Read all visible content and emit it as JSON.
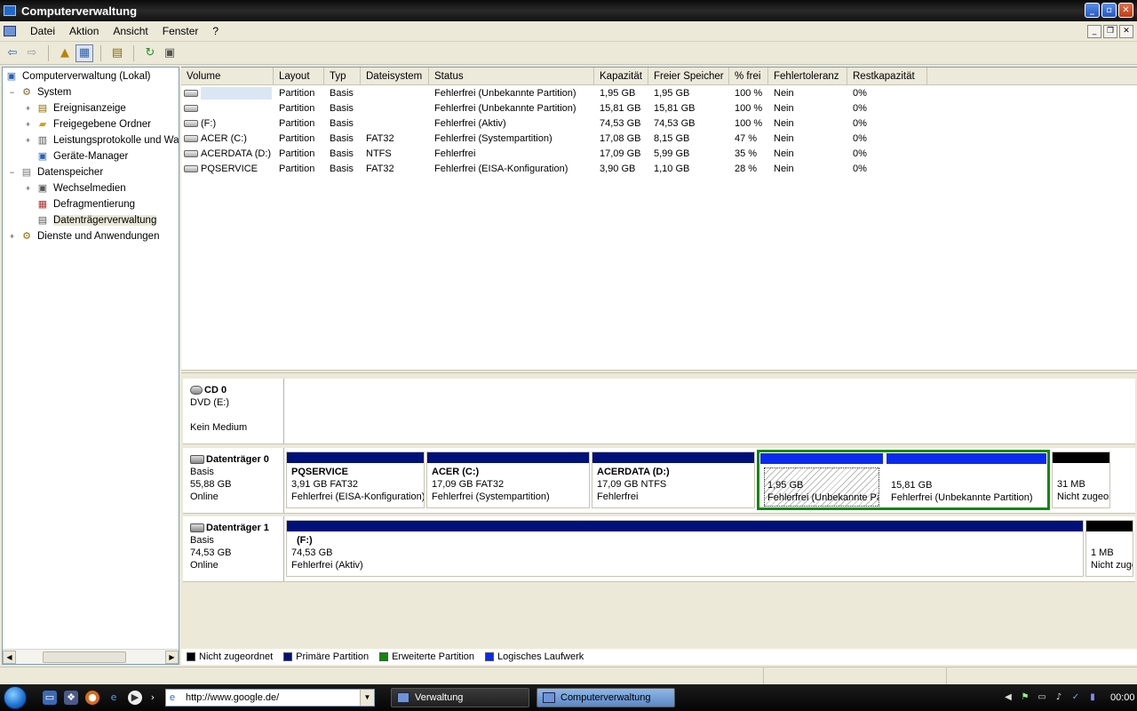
{
  "window": {
    "title": "Computerverwaltung"
  },
  "menu": [
    "Datei",
    "Aktion",
    "Ansicht",
    "Fenster",
    "?"
  ],
  "tree": [
    {
      "label": "Computerverwaltung (Lokal)",
      "level": 0,
      "expander": "",
      "icon": "computer-icon"
    },
    {
      "label": "System",
      "level": 1,
      "expander": "−",
      "icon": "system-icon"
    },
    {
      "label": "Ereignisanzeige",
      "level": 2,
      "expander": "+",
      "icon": "event-viewer-icon"
    },
    {
      "label": "Freigegebene Ordner",
      "level": 2,
      "expander": "+",
      "icon": "shared-folder-icon"
    },
    {
      "label": "Leistungsprotokolle und Warnungen",
      "level": 2,
      "expander": "+",
      "icon": "performance-icon"
    },
    {
      "label": "Geräte-Manager",
      "level": 2,
      "expander": "",
      "icon": "device-manager-icon"
    },
    {
      "label": "Datenspeicher",
      "level": 1,
      "expander": "−",
      "icon": "storage-icon"
    },
    {
      "label": "Wechselmedien",
      "level": 2,
      "expander": "+",
      "icon": "removable-media-icon"
    },
    {
      "label": "Defragmentierung",
      "level": 2,
      "expander": "",
      "icon": "defrag-icon"
    },
    {
      "label": "Datenträgerverwaltung",
      "level": 2,
      "expander": "",
      "icon": "disk-management-icon",
      "selected": true
    },
    {
      "label": "Dienste und Anwendungen",
      "level": 1,
      "expander": "+",
      "icon": "services-icon"
    }
  ],
  "volumes": {
    "columns": [
      "Volume",
      "Layout",
      "Typ",
      "Dateisystem",
      "Status",
      "Kapazität",
      "Freier Speicher",
      "% frei",
      "Fehlertoleranz",
      "Restkapazität"
    ],
    "rows": [
      [
        "",
        "Partition",
        "Basis",
        "",
        "Fehlerfrei (Unbekannte Partition)",
        "1,95 GB",
        "1,95 GB",
        "100 %",
        "Nein",
        "0%"
      ],
      [
        "",
        "Partition",
        "Basis",
        "",
        "Fehlerfrei (Unbekannte Partition)",
        "15,81 GB",
        "15,81 GB",
        "100 %",
        "Nein",
        "0%"
      ],
      [
        " (F:)",
        "Partition",
        "Basis",
        "",
        "Fehlerfrei (Aktiv)",
        "74,53 GB",
        "74,53 GB",
        "100 %",
        "Nein",
        "0%"
      ],
      [
        "ACER (C:)",
        "Partition",
        "Basis",
        "FAT32",
        "Fehlerfrei (Systempartition)",
        "17,08 GB",
        "8,15 GB",
        "47 %",
        "Nein",
        "0%"
      ],
      [
        "ACERDATA (D:)",
        "Partition",
        "Basis",
        "NTFS",
        "Fehlerfrei",
        "17,09 GB",
        "5,99 GB",
        "35 %",
        "Nein",
        "0%"
      ],
      [
        "PQSERVICE",
        "Partition",
        "Basis",
        "FAT32",
        "Fehlerfrei (EISA-Konfiguration)",
        "3,90 GB",
        "1,10 GB",
        "28 %",
        "Nein",
        "0%"
      ]
    ]
  },
  "disks": {
    "cd0": {
      "name": "CD 0",
      "type": "DVD (E:)",
      "status": "Kein Medium"
    },
    "disk0": {
      "name": "Datenträger 0",
      "type": "Basis",
      "size": "55,88 GB",
      "status": "Online",
      "partitions": [
        {
          "name": "PQSERVICE",
          "size": "3,91 GB FAT32",
          "status": "Fehlerfrei (EISA-Konfiguration)"
        },
        {
          "name": "ACER  (C:)",
          "size": "17,09 GB FAT32",
          "status": "Fehlerfrei (Systempartition)"
        },
        {
          "name": "ACERDATA  (D:)",
          "size": "17,09 GB NTFS",
          "status": "Fehlerfrei"
        },
        {
          "name": "",
          "size": "1,95 GB",
          "status": "Fehlerfrei (Unbekannte Partition)"
        },
        {
          "name": "",
          "size": "15,81 GB",
          "status": "Fehlerfrei (Unbekannte Partition)"
        },
        {
          "name": "",
          "size": "31 MB",
          "status": "Nicht zugeordnet"
        }
      ]
    },
    "disk1": {
      "name": "Datenträger 1",
      "type": "Basis",
      "size": "74,53 GB",
      "status": "Online",
      "partitions": [
        {
          "name": "(F:)",
          "size": "74,53 GB",
          "status": "Fehlerfrei (Aktiv)"
        },
        {
          "name": "",
          "size": "1 MB",
          "status": "Nicht zugeordnet"
        }
      ]
    }
  },
  "legend": [
    {
      "label": "Nicht zugeordnet",
      "color": "#000000"
    },
    {
      "label": "Primäre Partition",
      "color": "#00107a"
    },
    {
      "label": "Erweiterte Partition",
      "color": "#0a8a0a"
    },
    {
      "label": "Logisches Laufwerk",
      "color": "#0a2af0"
    }
  ],
  "taskbar": {
    "address": "http://www.google.de/",
    "tasks": [
      {
        "label": "Verwaltung",
        "active": false
      },
      {
        "label": "Computerverwaltung",
        "active": true
      }
    ],
    "clock": "00:00"
  }
}
